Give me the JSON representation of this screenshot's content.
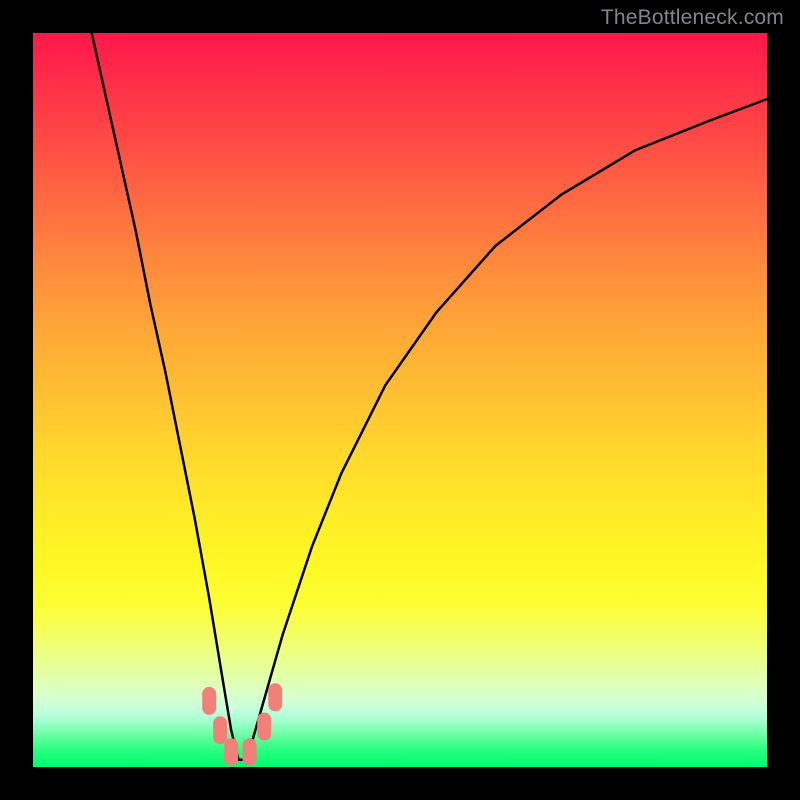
{
  "watermark": "TheBottleneck.com",
  "colors": {
    "frame": "#000000",
    "gradient_top": "#ff174a",
    "gradient_mid": "#ffd72c",
    "gradient_bottom": "#00ff71",
    "curve": "#000000",
    "marker": "#f08078"
  },
  "chart_data": {
    "type": "line",
    "title": "",
    "xlabel": "",
    "ylabel": "",
    "xlim": [
      0,
      100
    ],
    "ylim": [
      0,
      100
    ],
    "notes": "Bottleneck curve on a heat-gradient background. y≈100 means severe bottleneck (red), y≈0 means no bottleneck (green). The curve dips to ~0 around x≈28 (the balanced point).",
    "series": [
      {
        "name": "bottleneck-curve",
        "x": [
          8,
          10,
          12,
          14,
          16,
          18,
          20,
          22,
          24,
          26,
          27,
          28,
          29,
          30,
          32,
          34,
          38,
          42,
          48,
          55,
          63,
          72,
          82,
          92,
          100
        ],
        "y": [
          100,
          91,
          82,
          73,
          63,
          54,
          44,
          34,
          23,
          11,
          5,
          1,
          1,
          4,
          11,
          18,
          30,
          40,
          52,
          62,
          71,
          78,
          84,
          88,
          91
        ]
      }
    ],
    "markers": [
      {
        "x": 24.0,
        "y": 9.0
      },
      {
        "x": 25.5,
        "y": 5.0
      },
      {
        "x": 27.0,
        "y": 2.0
      },
      {
        "x": 29.5,
        "y": 2.0
      },
      {
        "x": 31.5,
        "y": 5.5
      },
      {
        "x": 33.0,
        "y": 9.5
      }
    ]
  }
}
